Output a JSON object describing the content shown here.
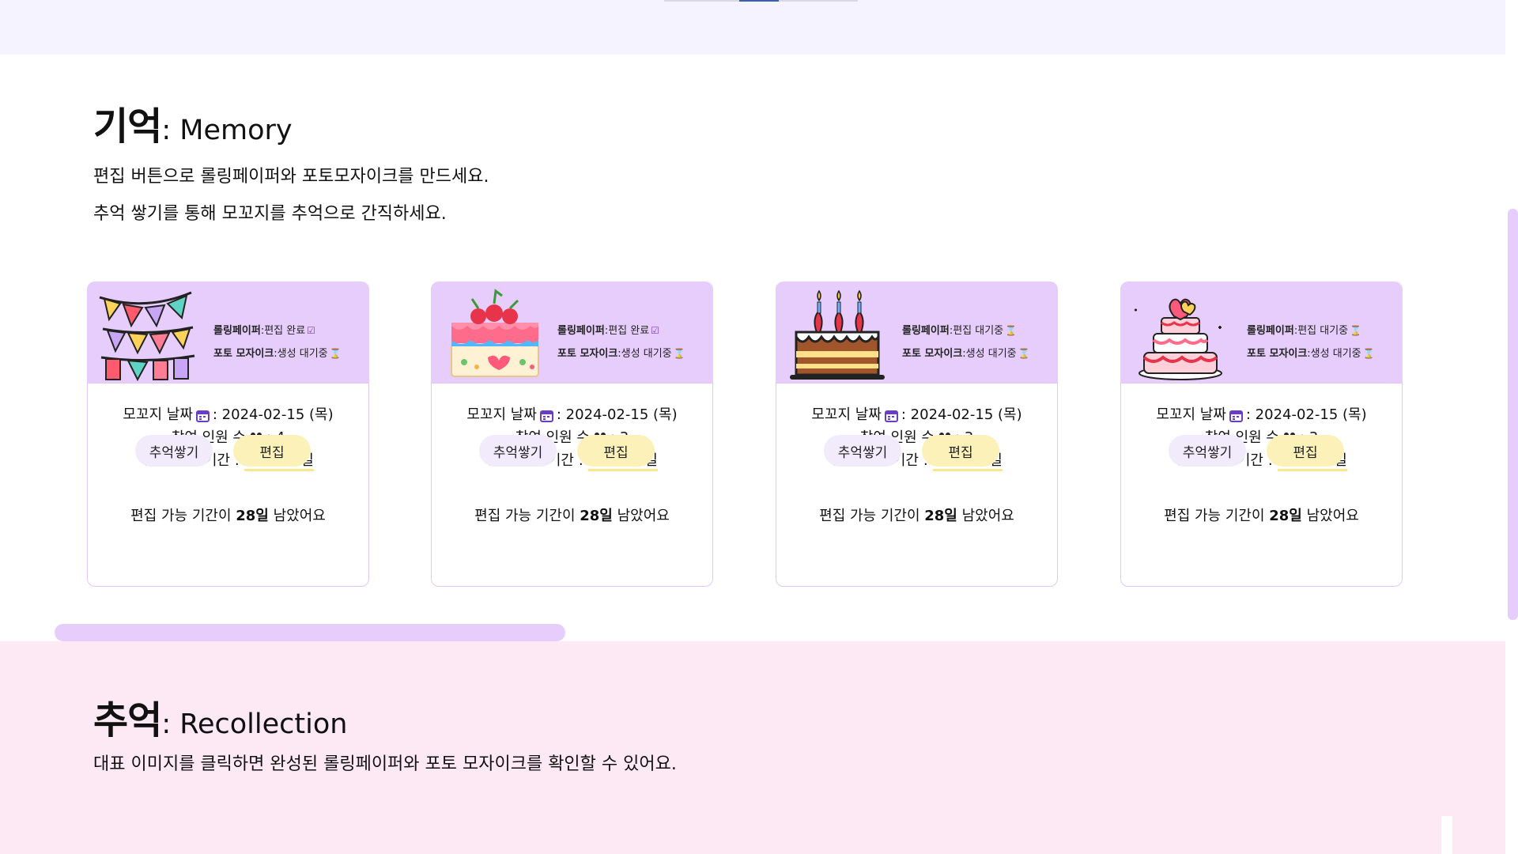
{
  "memory": {
    "title_ko": "기억",
    "title_en": ": Memory",
    "desc_1": "편집 버튼으로 롤링페이퍼와 포토모자이크를 만드세요.",
    "desc_2": "추억 쌓기를 통해 모꼬지를 추억으로 간직하세요."
  },
  "labels": {
    "rolling_paper": "롤링페이퍼",
    "photo_mosaic": "포토 모자이크",
    "date_label": "모꼬지 날짜",
    "participants_label": "참여 인원 수",
    "period_label": "편집 가능 기간 :",
    "remaining_prefix": "편집 가능 기간이",
    "remaining_suffix": "남았어요",
    "memory_button": "추억쌓기",
    "edit_button": "편집"
  },
  "cards": [
    {
      "image_icon": "bunting-icon",
      "rolling_status": ":편집 완료",
      "rolling_glyph": "☑",
      "mosaic_status": ":생성 대기중",
      "mosaic_glyph": "⌛",
      "date": ": 2024-02-15 (목)",
      "participants": ": 4",
      "period": "~3월 15일",
      "remaining": "28일"
    },
    {
      "image_icon": "cherry-cake-icon",
      "rolling_status": ":편집 완료",
      "rolling_glyph": "☑",
      "mosaic_status": ":생성 대기중",
      "mosaic_glyph": "⌛",
      "date": ": 2024-02-15 (목)",
      "participants": ": 3",
      "period": "~3월 15일",
      "remaining": "28일"
    },
    {
      "image_icon": "birthday-cake-icon",
      "rolling_status": ":편집 대기중",
      "rolling_glyph": "⌛",
      "mosaic_status": ":생성 대기중",
      "mosaic_glyph": "⌛",
      "date": ": 2024-02-15 (목)",
      "participants": ": 3",
      "period": "~3월 15일",
      "remaining": "28일"
    },
    {
      "image_icon": "wedding-cake-icon",
      "rolling_status": ":편집 대기중",
      "rolling_glyph": "⌛",
      "mosaic_status": ":생성 대기중",
      "mosaic_glyph": "⌛",
      "date": ": 2024-02-15 (목)",
      "participants": ": 3",
      "period": "~3월 15일",
      "remaining": "28일"
    }
  ],
  "recollection": {
    "title_ko": "추억",
    "title_en": ": Recollection",
    "desc": "대표 이미지를 클릭하면 완성된 롤링페이퍼와 포토 모자이크를 확인할 수 있어요."
  },
  "colors": {
    "card_header": "#e6cdfb",
    "memory_button": "#f1ebfb",
    "edit_button": "#fcf1b9",
    "top_band": "#f4f3ff",
    "bottom_band": "#fde9f3",
    "highlight": "#fce68b"
  }
}
